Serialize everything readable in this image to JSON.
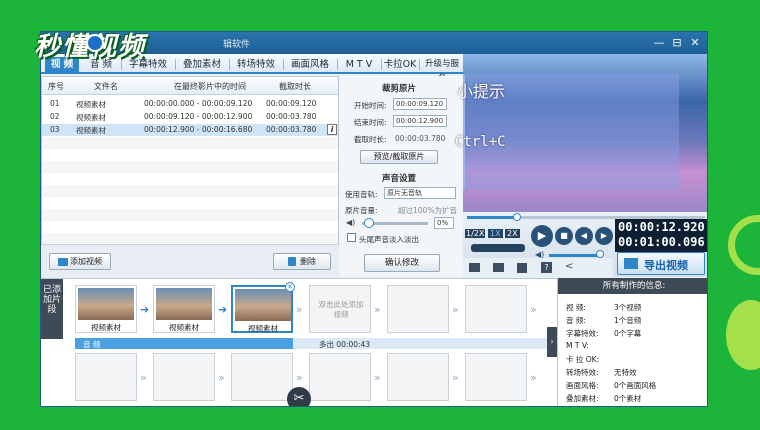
{
  "logo_text": "秒懂视频",
  "window": {
    "title": "辑软件",
    "controls": [
      "—",
      "⊟",
      "✕"
    ]
  },
  "tabs": [
    {
      "label": "视 频",
      "active": true
    },
    {
      "label": "音 频",
      "active": false
    },
    {
      "label": "字幕特效",
      "active": false
    },
    {
      "label": "叠加素材",
      "active": false
    },
    {
      "label": "转场特效",
      "active": false
    },
    {
      "label": "画面风格",
      "active": false
    },
    {
      "label": "M T V",
      "active": false
    },
    {
      "label": "卡拉OK",
      "active": false
    },
    {
      "label": "升级与服务",
      "active": false
    }
  ],
  "table": {
    "headers": [
      "序号",
      "文件名",
      "在最终影片中的时间",
      "截取时长"
    ],
    "rows": [
      {
        "index": "01",
        "name": "视频素材",
        "range": "00:00:00.000 - 00:00:09.120",
        "duration": "00:00:09.120",
        "selected": false
      },
      {
        "index": "02",
        "name": "视频素材",
        "range": "00:00:09.120 - 00:00:12.900",
        "duration": "00:00:03.780",
        "selected": false
      },
      {
        "index": "03",
        "name": "视频素材",
        "range": "00:00:12.900 - 00:00:16.680",
        "duration": "00:00:03.780",
        "selected": true
      }
    ],
    "info_icon": "i"
  },
  "left_buttons": {
    "add_video": "添加视频",
    "delete": "删除"
  },
  "crop": {
    "title": "裁剪原片",
    "start_label": "开始时间:",
    "start_value": "00:00:09.120",
    "end_label": "结束时间:",
    "end_value": "00:00:12.900",
    "duration_label": "截取时长:",
    "duration_value": "00:00:03.780",
    "preview_button": "预览/截取原片"
  },
  "sound": {
    "title": "声音设置",
    "track_label": "使用音轨:",
    "track_value": "原片无音轨",
    "volume_label": "原片音量:",
    "volume_hint": "超过100%为扩音",
    "volume_value": "0%",
    "volume_level": 0.1,
    "fade_label": "头尾声音淡入淡出",
    "confirm_button": "确认修改"
  },
  "preview": {
    "tip_title": "小提示",
    "tip_shortcut": "Ctrl+C",
    "progress": 0.21
  },
  "playback": {
    "speeds": [
      "1/2X",
      "1X",
      "2X"
    ],
    "current_time": "00:00:12.920",
    "total_time": "00:01:00.096",
    "volume_level": 0.85,
    "export_button": "导出视频"
  },
  "timeline": {
    "label": "已添加片段",
    "clips": [
      "视频素材",
      "视频素材",
      "视频素材"
    ],
    "placeholder": "双击此处添加视频",
    "audio_label": "音 频",
    "audio_extra": "多出 00:00:43"
  },
  "info": {
    "title": "所有制作的信息:",
    "rows": [
      {
        "k": "视  频:",
        "v": "3个视频"
      },
      {
        "k": "音  频:",
        "v": "1个音频"
      },
      {
        "k": "字幕特效:",
        "v": "0个字幕"
      },
      {
        "k": "M  T  V:",
        "v": ""
      },
      {
        "k": "卡 拉 OK:",
        "v": ""
      },
      {
        "k": "转场特效:",
        "v": "无特效"
      },
      {
        "k": "画面风格:",
        "v": "0个画面风格"
      },
      {
        "k": "叠加素材:",
        "v": "0个素材"
      }
    ]
  }
}
